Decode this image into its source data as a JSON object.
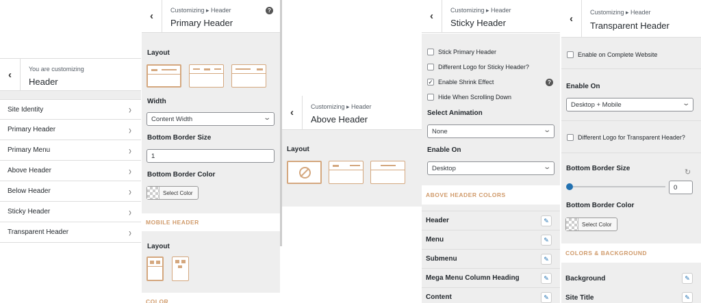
{
  "panel1": {
    "header_small": "You are customizing",
    "header_big": "Header",
    "items": [
      {
        "label": "Site Identity"
      },
      {
        "label": "Primary Header"
      },
      {
        "label": "Primary Menu"
      },
      {
        "label": "Above Header"
      },
      {
        "label": "Below Header"
      },
      {
        "label": "Sticky Header"
      },
      {
        "label": "Transparent Header"
      }
    ]
  },
  "panel2": {
    "header_small": "Customizing ▸ Header",
    "header_big": "Primary Header",
    "layout_label": "Layout",
    "width_label": "Width",
    "width_value": "Content Width",
    "border_size_label": "Bottom Border Size",
    "border_size_value": "1",
    "border_color_label": "Bottom Border Color",
    "select_color": "Select Color",
    "mobile_section": "MOBILE HEADER",
    "mobile_layout_label": "Layout",
    "colors_section": "COLOR"
  },
  "panel3": {
    "header_small": "Customizing ▸ Header",
    "header_big": "Above Header",
    "layout_label": "Layout"
  },
  "panel4": {
    "header_small": "Customizing ▸ Header",
    "header_big": "Sticky Header",
    "checkboxes": [
      {
        "label": "Stick Primary Header",
        "checked": false
      },
      {
        "label": "Different Logo for Sticky Header?",
        "checked": false
      },
      {
        "label": "Enable Shrink Effect",
        "checked": true
      },
      {
        "label": "Hide When Scrolling Down",
        "checked": false
      }
    ],
    "animation_label": "Select Animation",
    "animation_value": "None",
    "enable_on_label": "Enable On",
    "enable_on_value": "Desktop",
    "colors_section": "ABOVE HEADER COLORS",
    "color_rows": [
      {
        "label": "Header"
      },
      {
        "label": "Menu"
      },
      {
        "label": "Submenu"
      },
      {
        "label": "Mega Menu Column Heading"
      },
      {
        "label": "Content"
      }
    ]
  },
  "panel5": {
    "header_small": "Customizing ▸ Header",
    "header_big": "Transparent Header",
    "complete_site_label": "Enable on Complete Website",
    "enable_on_label": "Enable On",
    "enable_on_value": "Desktop + Mobile",
    "diff_logo_label": "Different Logo for Transparent Header?",
    "border_size_label": "Bottom Border Size",
    "border_size_value": "0",
    "border_color_label": "Bottom Border Color",
    "select_color": "Select Color",
    "colors_section": "COLORS & BACKGROUND",
    "color_rows": [
      {
        "label": "Background"
      },
      {
        "label": "Site Title"
      }
    ]
  },
  "colors": {
    "accent": "#d4a77e",
    "link_blue": "#2271b1",
    "panel_gray": "#eeeeee"
  }
}
